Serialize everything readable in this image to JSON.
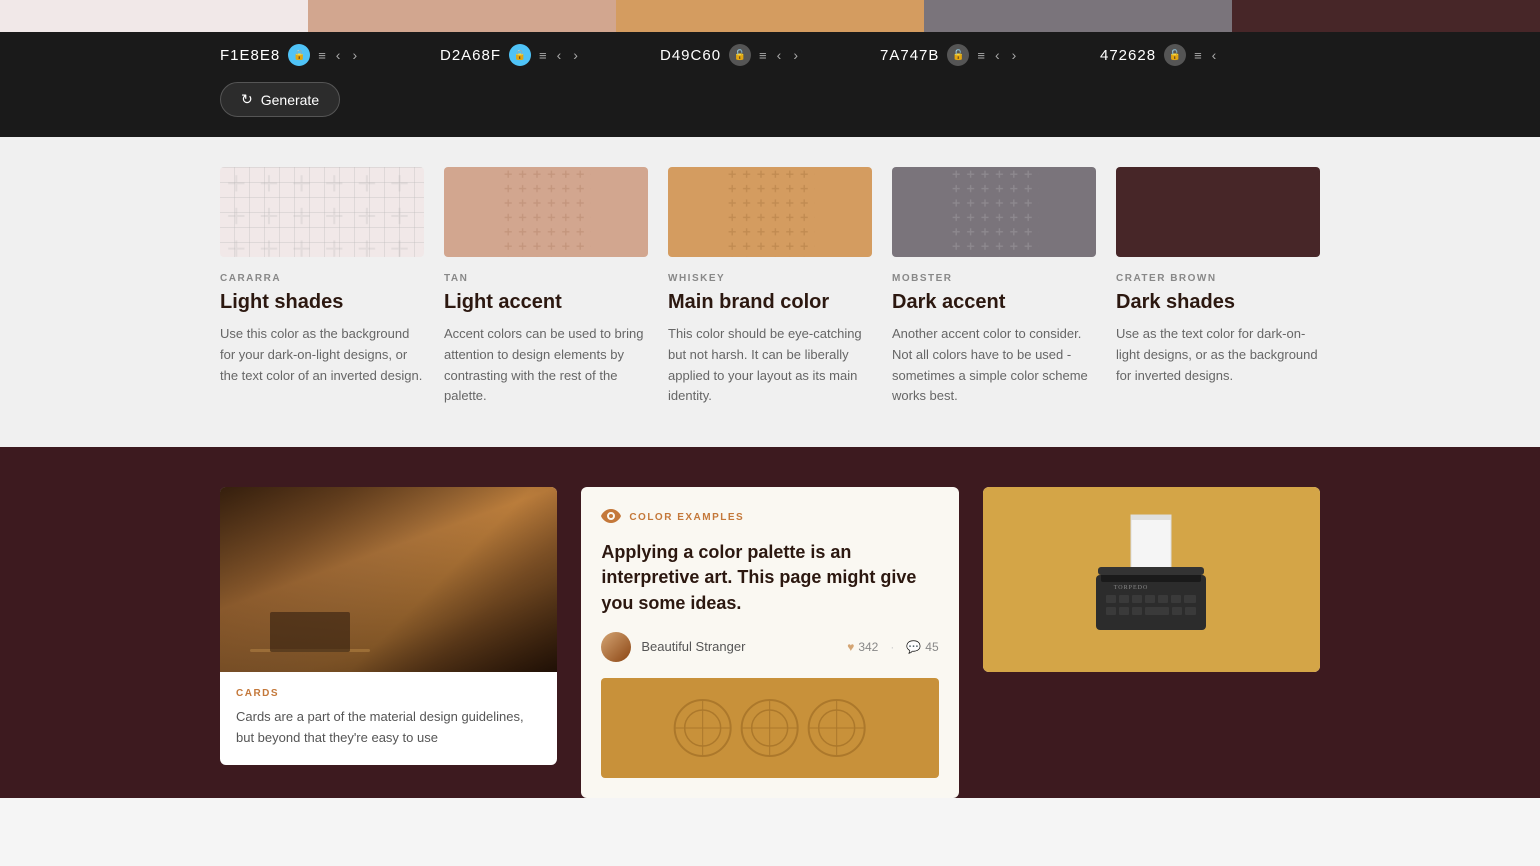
{
  "colors": {
    "swatch1": {
      "hex": "F1E8E8",
      "bg": "#f1e8e8"
    },
    "swatch2": {
      "hex": "D2A68F",
      "bg": "#d2a68f"
    },
    "swatch3": {
      "hex": "D49C60",
      "bg": "#d49c60"
    },
    "swatch4": {
      "hex": "7A747B",
      "bg": "#7a747b"
    },
    "swatch5": {
      "hex": "472628",
      "bg": "#472628"
    }
  },
  "controls": [
    {
      "hex": "F1E8E8",
      "locked": true,
      "lockColor": "blue"
    },
    {
      "hex": "D2A68F",
      "locked": true,
      "lockColor": "blue"
    },
    {
      "hex": "D49C60",
      "locked": false,
      "lockColor": "grey"
    },
    {
      "hex": "7A747B",
      "locked": false,
      "lockColor": "grey"
    },
    {
      "hex": "472628",
      "locked": false,
      "lockColor": "grey"
    }
  ],
  "generate": {
    "label": "Generate"
  },
  "palette": [
    {
      "swatchColor": "#f1e8e8",
      "pattern": true,
      "label": "CARARRA",
      "title": "Light shades",
      "desc": "Use this color as the background for your dark-on-light designs, or the text color of an inverted design."
    },
    {
      "swatchColor": "#d2a68f",
      "pattern": true,
      "label": "TAN",
      "title": "Light accent",
      "desc": "Accent colors can be used to bring attention to design elements by contrasting with the rest of the palette."
    },
    {
      "swatchColor": "#d49c60",
      "pattern": true,
      "label": "WHISKEY",
      "title": "Main brand color",
      "desc": "This color should be eye-catching but not harsh. It can be liberally applied to your layout as its main identity."
    },
    {
      "swatchColor": "#7a747b",
      "pattern": true,
      "label": "MOBSTER",
      "title": "Dark accent",
      "desc": "Another accent color to consider. Not all colors have to be used - sometimes a simple color scheme works best."
    },
    {
      "swatchColor": "#472628",
      "pattern": false,
      "label": "CRATER BROWN",
      "title": "Dark shades",
      "desc": "Use as the text color for dark-on-light designs, or as the background for inverted designs."
    }
  ],
  "bottom": {
    "cards_label": "CARDS",
    "cards_desc": "Cards are a part of the material design guidelines, but beyond that they're easy to use",
    "color_examples_tag": "COLOR EXAMPLES",
    "color_examples_title": "Applying a color palette is an interpretive art. This page might give you some ideas.",
    "author": "Beautiful Stranger",
    "likes": "342",
    "comments": "45"
  }
}
